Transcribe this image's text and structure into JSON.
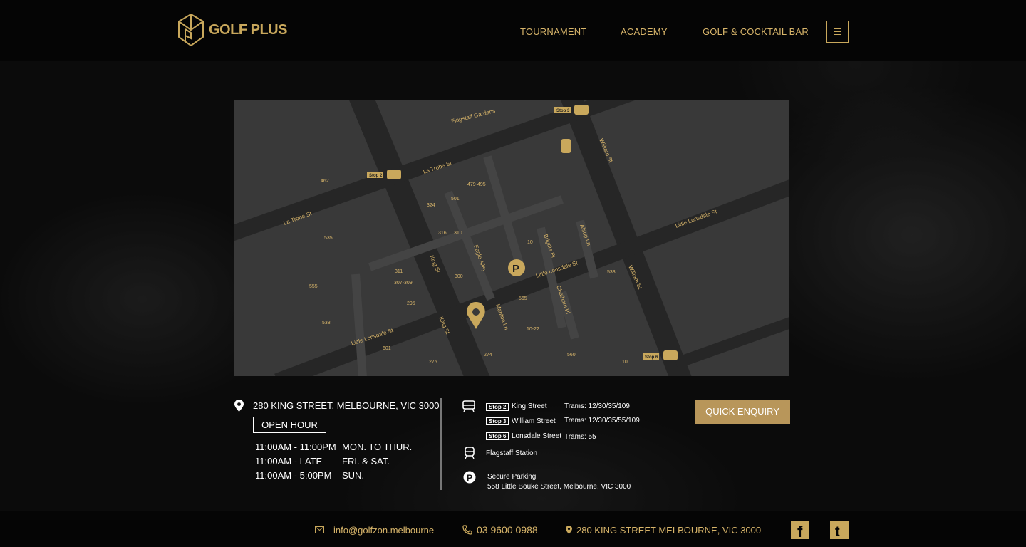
{
  "brand": {
    "name": "GOLF PLUS",
    "accent": "#c9a85c",
    "icon": "golfplus-logo-icon"
  },
  "nav": {
    "items": [
      "TOURNAMENT",
      "ACADEMY",
      "GOLF & COCKTAIL BAR"
    ],
    "menu_icon": "hamburger-icon"
  },
  "map": {
    "streets": [
      "Flagstaff Gardens",
      "La Trobe St",
      "La Trobe St",
      "William St",
      "William St",
      "King St",
      "King St",
      "Little Lonsdale St",
      "Little Lonsdale St",
      "Little Lonsdale St",
      "Eagle Alley",
      "Brights Pl",
      "Alsop Ln",
      "Chatham Pl",
      "Manton Ln"
    ],
    "numbers": [
      "462",
      "535",
      "555",
      "538",
      "601",
      "275",
      "274",
      "565",
      "10-22",
      "560",
      "10",
      "533",
      "10",
      "479-495",
      "501",
      "324",
      "316",
      "310",
      "300",
      "311",
      "307-309",
      "295"
    ],
    "stops": [
      "Stop 3",
      "Stop 2",
      "Stop 6"
    ]
  },
  "address": {
    "text": "280 KING STREET, MELBOURNE, VIC 3000",
    "icon": "location-pin-icon"
  },
  "hours": {
    "label": "OPEN HOUR",
    "rows": [
      {
        "time": "11:00AM - 11:00PM",
        "days": "MON. TO THUR."
      },
      {
        "time": "11:00AM - LATE",
        "days": "FRI. & SAT."
      },
      {
        "time": "11:00AM - 5:00PM",
        "days": "SUN."
      }
    ]
  },
  "transport": {
    "trams": [
      {
        "stop": "Stop 2",
        "street": "King Street",
        "routes": "Trams: 12/30/35/109"
      },
      {
        "stop": "Stop 3",
        "street": "William Street",
        "routes": "Trams: 12/30/35/55/109"
      },
      {
        "stop": "Stop 6",
        "street": "Lonsdale Street",
        "routes": "Trams: 55"
      }
    ],
    "train": "Flagstaff Station",
    "parking": {
      "title": "Secure Parking",
      "address": "558 Little Bouke Street, Melbourne, VIC 3000"
    }
  },
  "cta": {
    "label": "QUICK ENQUIRY"
  },
  "footer": {
    "email": "info@golfzon.melbourne",
    "phone": "03 9600 0988",
    "address": "280 KING STREET MELBOURNE, VIC 3000",
    "social": [
      "facebook-icon",
      "twitter-icon"
    ]
  }
}
